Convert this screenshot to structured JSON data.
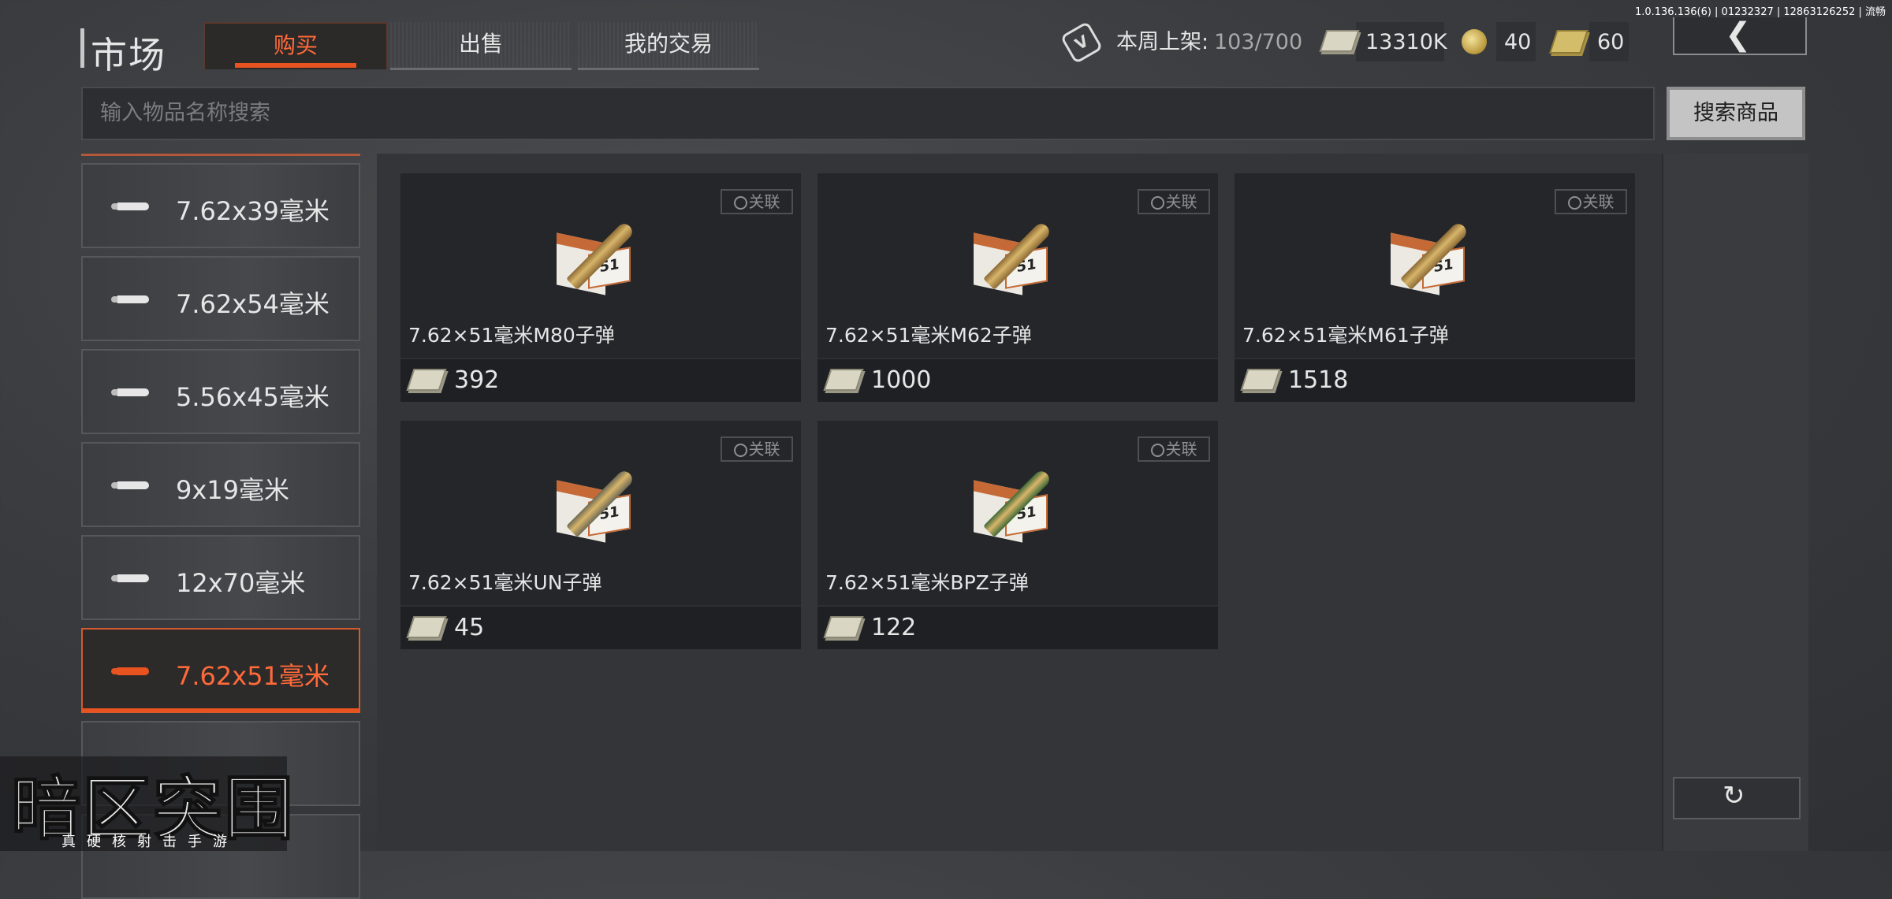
{
  "version": "1.0.136.136(6) | 01232327 | 12863126252 | 流畅",
  "title": "市场",
  "tabs": [
    {
      "label": "购买",
      "selected": true
    },
    {
      "label": "出售",
      "selected": false
    },
    {
      "label": "我的交易",
      "selected": false
    }
  ],
  "stats": {
    "weekly_label": "本周上架:",
    "weekly_value": "103/700",
    "cash": "13310K",
    "coins": "40",
    "gold_cash": "60"
  },
  "search": {
    "placeholder": "输入物品名称搜索",
    "button": "搜索商品"
  },
  "categories": [
    {
      "label": "7.62x39毫米",
      "selected": false
    },
    {
      "label": "7.62x54毫米",
      "selected": false
    },
    {
      "label": "5.56x45毫米",
      "selected": false
    },
    {
      "label": "9x19毫米",
      "selected": false
    },
    {
      "label": "12x70毫米",
      "selected": false
    },
    {
      "label": "7.62x51毫米",
      "selected": true
    }
  ],
  "items": [
    {
      "name": "7.62×51毫米M80子弹",
      "price": "392",
      "relate": "关联",
      "bullet_color": "#8b6a35",
      "tip_color": "#a07a3c"
    },
    {
      "name": "7.62×51毫米M62子弹",
      "price": "1000",
      "relate": "关联",
      "bullet_color": "#8b6a35",
      "tip_color": "#c8321e"
    },
    {
      "name": "7.62×51毫米M61子弹",
      "price": "1518",
      "relate": "关联",
      "bullet_color": "#8b6a35",
      "tip_color": "#a07a3c"
    },
    {
      "name": "7.62×51毫米UN子弹",
      "price": "45",
      "relate": "关联",
      "bullet_color": "#6e6a55",
      "tip_color": "#8d7a4c"
    },
    {
      "name": "7.62×51毫米BPZ子弹",
      "price": "122",
      "relate": "关联",
      "bullet_color": "#3f6a36",
      "tip_color": "#a07a3c"
    }
  ],
  "logo": {
    "title": "暗区突围",
    "subtitle": "真硬核射击手游"
  },
  "colors": {
    "accent": "#e8531f",
    "accent_text": "#ff6a3a"
  }
}
